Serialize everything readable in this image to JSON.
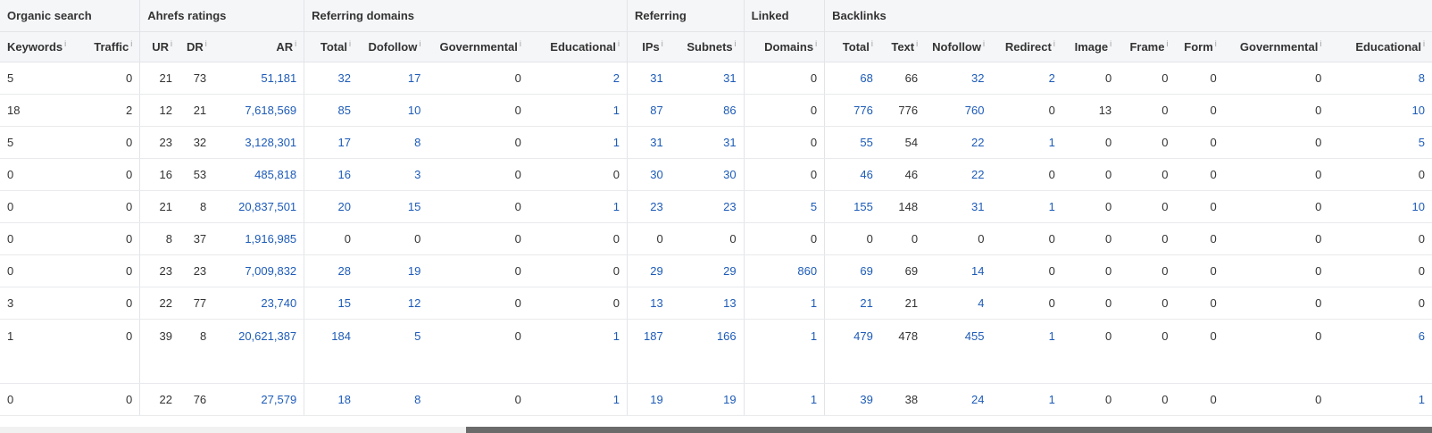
{
  "groups": [
    "Organic search",
    "Ahrefs ratings",
    "Referring domains",
    "Referring",
    "Linked",
    "Backlinks"
  ],
  "columns": [
    "Keywords",
    "Traffic",
    "UR",
    "DR",
    "AR",
    "Total",
    "Dofollow",
    "Governmental",
    "Educational",
    "IPs",
    "Subnets",
    "Domains",
    "Total",
    "Text",
    "Nofollow",
    "Redirect",
    "Image",
    "Frame",
    "Form",
    "Governmental",
    "Educational"
  ],
  "info_glyph": "i",
  "rows": [
    [
      "5",
      "0",
      "21",
      "73",
      "51,181",
      "32",
      "17",
      "0",
      "2",
      "31",
      "31",
      "0",
      "68",
      "66",
      "32",
      "2",
      "0",
      "0",
      "0",
      "0",
      "8"
    ],
    [
      "18",
      "2",
      "12",
      "21",
      "7,618,569",
      "85",
      "10",
      "0",
      "1",
      "87",
      "86",
      "0",
      "776",
      "776",
      "760",
      "0",
      "13",
      "0",
      "0",
      "0",
      "10"
    ],
    [
      "5",
      "0",
      "23",
      "32",
      "3,128,301",
      "17",
      "8",
      "0",
      "1",
      "31",
      "31",
      "0",
      "55",
      "54",
      "22",
      "1",
      "0",
      "0",
      "0",
      "0",
      "5"
    ],
    [
      "0",
      "0",
      "16",
      "53",
      "485,818",
      "16",
      "3",
      "0",
      "0",
      "30",
      "30",
      "0",
      "46",
      "46",
      "22",
      "0",
      "0",
      "0",
      "0",
      "0",
      "0"
    ],
    [
      "0",
      "0",
      "21",
      "8",
      "20,837,501",
      "20",
      "15",
      "0",
      "1",
      "23",
      "23",
      "5",
      "155",
      "148",
      "31",
      "1",
      "0",
      "0",
      "0",
      "0",
      "10"
    ],
    [
      "0",
      "0",
      "8",
      "37",
      "1,916,985",
      "0",
      "0",
      "0",
      "0",
      "0",
      "0",
      "0",
      "0",
      "0",
      "0",
      "0",
      "0",
      "0",
      "0",
      "0",
      "0"
    ],
    [
      "0",
      "0",
      "23",
      "23",
      "7,009,832",
      "28",
      "19",
      "0",
      "0",
      "29",
      "29",
      "860",
      "69",
      "69",
      "14",
      "0",
      "0",
      "0",
      "0",
      "0",
      "0"
    ],
    [
      "3",
      "0",
      "22",
      "77",
      "23,740",
      "15",
      "12",
      "0",
      "0",
      "13",
      "13",
      "1",
      "21",
      "21",
      "4",
      "0",
      "0",
      "0",
      "0",
      "0",
      "0"
    ],
    [
      "1",
      "0",
      "39",
      "8",
      "20,621,387",
      "184",
      "5",
      "0",
      "1",
      "187",
      "166",
      "1",
      "479",
      "478",
      "455",
      "1",
      "0",
      "0",
      "0",
      "0",
      "6"
    ],
    [
      "0",
      "0",
      "22",
      "76",
      "27,579",
      "18",
      "8",
      "0",
      "1",
      "19",
      "19",
      "1",
      "39",
      "38",
      "24",
      "1",
      "0",
      "0",
      "0",
      "0",
      "1"
    ]
  ],
  "colors": {
    "link": "#1d5bb8",
    "header_bg": "#f5f6f8",
    "border": "#e2e4e8",
    "scroll_thumb": "#6b6b6b"
  }
}
